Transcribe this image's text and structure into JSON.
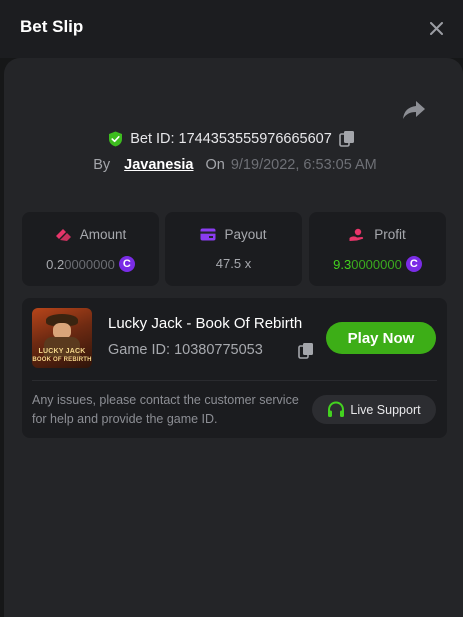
{
  "header": {
    "title": "Bet Slip"
  },
  "bet": {
    "id_label": "Bet ID: 1744353555976665607",
    "by_label": "By",
    "user": "Javanesia",
    "on_label": "On",
    "date": "9/19/2022, 6:53:05 AM"
  },
  "stats": {
    "amount": {
      "label": "Amount",
      "value_main": "0.2",
      "value_rest": "0000000",
      "coin": "C"
    },
    "payout": {
      "label": "Payout",
      "value": "47.5 x"
    },
    "profit": {
      "label": "Profit",
      "value_main": "9.3",
      "value_rest": "0000000",
      "coin": "C"
    }
  },
  "game": {
    "name": "Lucky Jack - Book Of Rebirth",
    "id_label": "Game ID: 10380775053",
    "thumb_title": "LUCKY JACK",
    "thumb_subtitle": "BOOK OF REBIRTH",
    "play_label": "Play Now"
  },
  "support": {
    "notice": "Any issues, please contact the customer service for help and provide the game ID.",
    "button_label": "Live Support"
  },
  "colors": {
    "accent_green": "#3dae17",
    "profit_green": "#43d21f",
    "coin_purple": "#7a2ce6",
    "panel": "#242528",
    "card": "#1b1c1f"
  },
  "icons": {
    "close": "close-icon",
    "share": "share-icon",
    "verified": "shield-check-icon",
    "copy": "copy-icon",
    "amount": "chip-icon",
    "payout": "card-icon",
    "profit": "hand-coin-icon",
    "coin": "coin-icon",
    "support": "headphones-icon"
  }
}
